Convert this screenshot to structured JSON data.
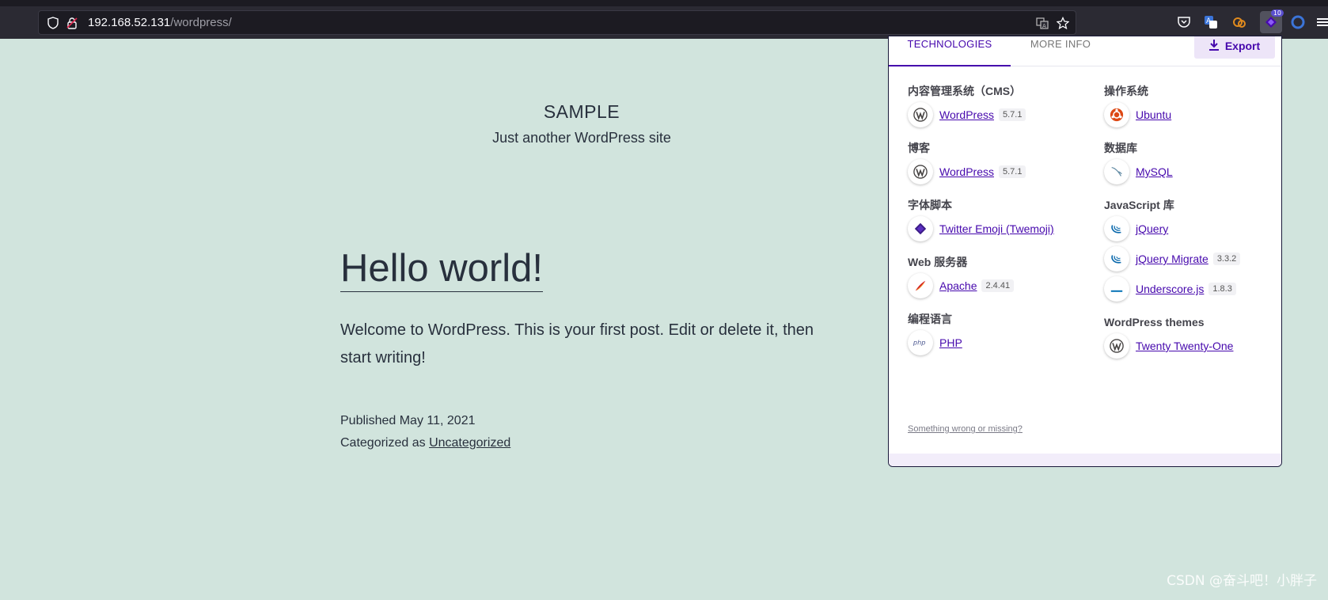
{
  "browser": {
    "url_host": "192.168.52.131",
    "url_path": "/wordpress/",
    "extension_badge": "10"
  },
  "site": {
    "title": "SAMPLE",
    "description": "Just another WordPress site"
  },
  "post": {
    "title": "Hello world!",
    "body": "Welcome to WordPress. This is your first post. Edit or delete it, then start writing!",
    "published_label": "Published May 11, 2021",
    "categorized_prefix": "Categorized as ",
    "category": "Uncategorized"
  },
  "popup": {
    "tabs": {
      "technologies": "TECHNOLOGIES",
      "more_info": "MORE INFO"
    },
    "export_label": "Export",
    "feedback": "Something wrong or missing?",
    "left": [
      {
        "title": "内容管理系统（CMS）",
        "items": [
          {
            "name": "WordPress",
            "version": "5.7.1",
            "icon": "wordpress-icon"
          }
        ]
      },
      {
        "title": "博客",
        "items": [
          {
            "name": "WordPress",
            "version": "5.7.1",
            "icon": "wordpress-icon"
          }
        ]
      },
      {
        "title": "字体脚本",
        "items": [
          {
            "name": "Twitter Emoji (Twemoji)",
            "version": "",
            "icon": "twemoji-icon"
          }
        ]
      },
      {
        "title": "Web 服务器",
        "items": [
          {
            "name": "Apache",
            "version": "2.4.41",
            "icon": "apache-icon"
          }
        ]
      },
      {
        "title": "编程语言",
        "items": [
          {
            "name": "PHP",
            "version": "",
            "icon": "php-icon"
          }
        ]
      }
    ],
    "right": [
      {
        "title": "操作系统",
        "items": [
          {
            "name": "Ubuntu",
            "version": "",
            "icon": "ubuntu-icon"
          }
        ]
      },
      {
        "title": "数据库",
        "items": [
          {
            "name": "MySQL",
            "version": "",
            "icon": "mysql-icon"
          }
        ]
      },
      {
        "title": "JavaScript 库",
        "items": [
          {
            "name": "jQuery",
            "version": "",
            "icon": "jquery-icon"
          },
          {
            "name": "jQuery Migrate",
            "version": "3.3.2",
            "icon": "jquery-icon"
          },
          {
            "name": "Underscore.js",
            "version": "1.8.3",
            "icon": "underscore-icon"
          }
        ]
      },
      {
        "title": "WordPress themes",
        "items": [
          {
            "name": "Twenty Twenty-One",
            "version": "",
            "icon": "wordpress-icon"
          }
        ]
      }
    ]
  },
  "watermark": "CSDN @奋斗吧！小胖子",
  "colors": {
    "page_bg": "#d1e4dd",
    "accent": "#4608ad",
    "text": "#28303d"
  }
}
